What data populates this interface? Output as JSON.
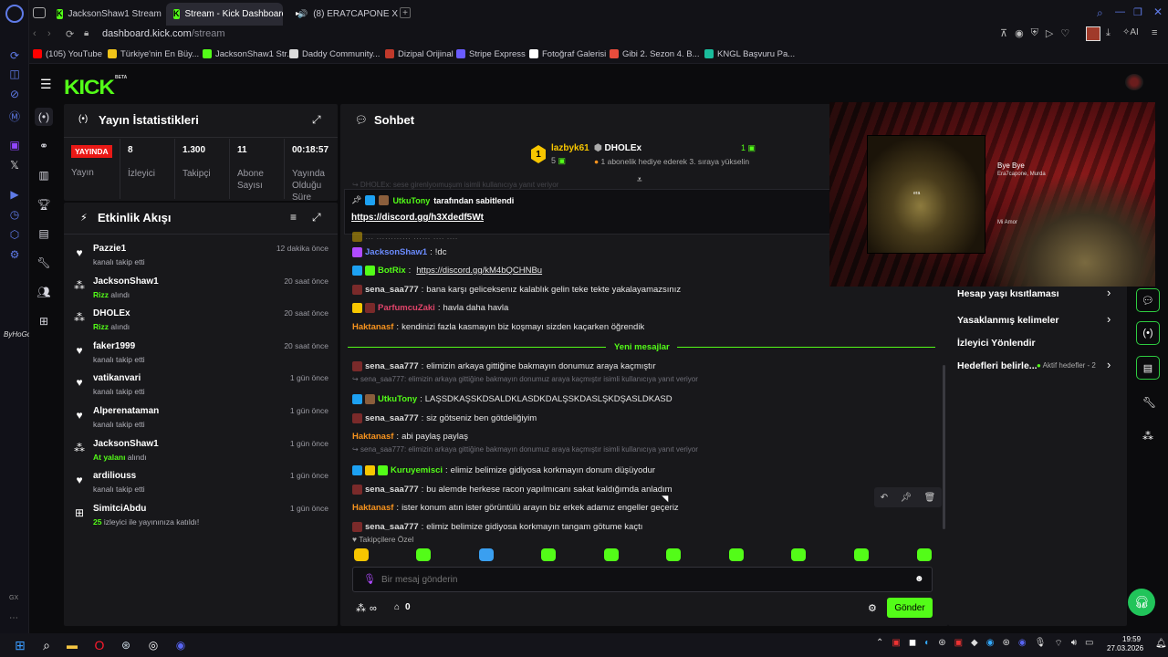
{
  "browser": {
    "tabs": [
      {
        "label": "JacksonShaw1 Stream - W",
        "favicon": "kick"
      },
      {
        "label": "Stream - Kick Dashboard",
        "favicon": "kick",
        "active": true
      },
      {
        "label": "(8) ERA7CAPONE X M",
        "favicon": "youtube"
      }
    ],
    "url_domain": "dashboard.kick.com",
    "url_path": "/stream",
    "toolbar_ai": "AI",
    "bookmarks": [
      {
        "label": "(105) YouTube",
        "color": "#ff0000"
      },
      {
        "label": "Türkiye'nin En Büy...",
        "color": "#f0c419"
      },
      {
        "label": "JacksonShaw1 Str...",
        "color": "#53fc18"
      },
      {
        "label": "Daddy Community...",
        "color": "#dddddd"
      },
      {
        "label": "Dizipal Orijinal",
        "color": "#c0392b"
      },
      {
        "label": "Stripe Express",
        "color": "#6a5cff"
      },
      {
        "label": "Fotoğraf Galerisi",
        "color": "#ffffff"
      },
      {
        "label": "Gibi 2. Sezon 4. B...",
        "color": "#e74c3c"
      },
      {
        "label": "KNGL Başvuru Pa...",
        "color": "#1abc9c"
      }
    ]
  },
  "header": {
    "logo": "KICK",
    "beta": "BETA"
  },
  "stats": {
    "title": "Yayın İstatistikleri",
    "live_badge": "YAYINDA",
    "live_label": "Yayın",
    "items": [
      {
        "value": "8",
        "label": "İzleyici"
      },
      {
        "value": "1.300",
        "label": "Takipçi"
      },
      {
        "value": "11",
        "label": "Abone Sayısı"
      },
      {
        "value": "00:18:57",
        "label": "Yayında Olduğu Süre"
      }
    ]
  },
  "activity": {
    "title": "Etkinlik Akışı",
    "items": [
      {
        "name": "Pazzie1",
        "desc": "kanalı takip etti",
        "hl": "",
        "time": "12 dakika önce",
        "icon": "heart"
      },
      {
        "name": "JacksonShaw1",
        "hl": "Rizz",
        "desc": " alındı",
        "time": "20 saat önce",
        "icon": "points"
      },
      {
        "name": "DHOLEx",
        "hl": "Rizz",
        "desc": " alındı",
        "time": "20 saat önce",
        "icon": "points"
      },
      {
        "name": "faker1999",
        "desc": "kanalı takip etti",
        "hl": "",
        "time": "20 saat önce",
        "icon": "heart"
      },
      {
        "name": "vatikanvari",
        "desc": "kanalı takip etti",
        "hl": "",
        "time": "1 gün önce",
        "icon": "heart"
      },
      {
        "name": "Alperenataman",
        "desc": "kanalı takip etti",
        "hl": "",
        "time": "1 gün önce",
        "icon": "heart"
      },
      {
        "name": "JacksonShaw1",
        "hl": "At yalanı",
        "desc": " alındı",
        "time": "1 gün önce",
        "icon": "points"
      },
      {
        "name": "ardiliouss",
        "desc": "kanalı takip etti",
        "hl": "",
        "time": "1 gün önce",
        "icon": "heart"
      },
      {
        "name": "SimitciAbdu",
        "hl": "25",
        "desc": " izleyici ile yayınınıza katıldı!",
        "time": "1 gün önce",
        "icon": "raid"
      }
    ]
  },
  "chat": {
    "title": "Sohbet",
    "top_gifter": {
      "rank": "1",
      "name": "lazbyk61",
      "count": "5"
    },
    "gift_user": "DHOLEx",
    "gift_count": "1",
    "gift_text": "1 abonelik hediye ederek 3. sıraya yükselin",
    "pinned_by": "UtkuTony",
    "pinned_suffix": "tarafından sabitlendi",
    "pinned_link": "https://discord.gg/h3Xdedf5Wt",
    "messages": [
      {
        "user": "JacksonShaw1",
        "color": "#6b8cff",
        "text": " !dc"
      },
      {
        "user": "BotRix",
        "color": "#53fc18",
        "text": " ",
        "link": "https://discord.gg/kM4bQCHNBu"
      },
      {
        "user": "sena_saa777",
        "color": "#dddddd",
        "text": " bana karşı geliceksenız kalablık gelin teke tekte yakalayamazsınız"
      },
      {
        "user": "ParfumcuZaki",
        "color": "#e0446a",
        "text": " havla daha havla"
      },
      {
        "user": "Haktanasf",
        "color": "#f7931e",
        "text": " kendinizi fazla kasmayın biz koşmayı sizden kaçarken öğrendik"
      }
    ],
    "new_messages": "Yeni mesajlar",
    "new": [
      {
        "user": "sena_saa777",
        "color": "#dddddd",
        "text": " elimizin arkaya gittiğine bakmayın donumuz araya kaçmıştır"
      },
      {
        "reply": "sena_saa777: elimizin arkaya gittiğine bakmayın donumuz araya kaçmıştır isimli kullanıcıya yanıt veriyor"
      },
      {
        "user": "UtkuTony",
        "color": "#53fc18",
        "text": " LAŞSDKAŞSKDSALDKLASDKDALŞSKDASLŞKDŞASLDKASD"
      },
      {
        "user": "sena_saa777",
        "color": "#dddddd",
        "text": " siz götseniz ben götdeliğiyim"
      },
      {
        "user": "Haktanasf",
        "color": "#f7931e",
        "text": " abi paylaş paylaş"
      },
      {
        "reply": "sena_saa777: elimizin arkaya gittiğine bakmayın donumuz araya kaçmıştır isimli kullanıcıya yanıt veriyor"
      },
      {
        "user": "Kuruyemisci",
        "color": "#53fc18",
        "text": " elimiz belimize gidiyosa korkmayın donum düşüyodur"
      },
      {
        "user": "sena_saa777",
        "color": "#dddddd",
        "text": " bu alemde herkese racon yapılmıcanı sakat kaldığımda anladım"
      },
      {
        "user": "Haktanasf",
        "color": "#f7931e",
        "text": " ister konum atın ister görüntülü arayın biz erkek adamız engeller geçeriz"
      },
      {
        "user": "sena_saa777",
        "color": "#dddddd",
        "text": " elimiz belimize gidiyosa korkmayın tangam götume kaçtı"
      }
    ],
    "followers_only": "Takipçilere Özel",
    "input_placeholder": "Bir mesaj gönderin",
    "points": "∞",
    "store_count": "0",
    "send": "Gönder"
  },
  "settings": {
    "items": [
      "Hesap yaşı kısıtlaması",
      "Yasaklanmış kelimeler",
      "İzleyici Yönlendir",
      "Hedefleri belirle..."
    ],
    "goal_status": "Aktif hedefler - 2"
  },
  "video_overlay": {
    "song": "Bye Bye",
    "artist": "Era7capone, Murda",
    "lyric": "Mi Amor",
    "cover_brand": "era"
  },
  "desktop_watermark": "ByHoGofte",
  "taskbar": {
    "time": "19:59",
    "date": "27.03.2026",
    "gx": "GX"
  },
  "colors": {
    "kick_green": "#53fc18",
    "panel": "#18181b",
    "live_red": "#e91916"
  }
}
